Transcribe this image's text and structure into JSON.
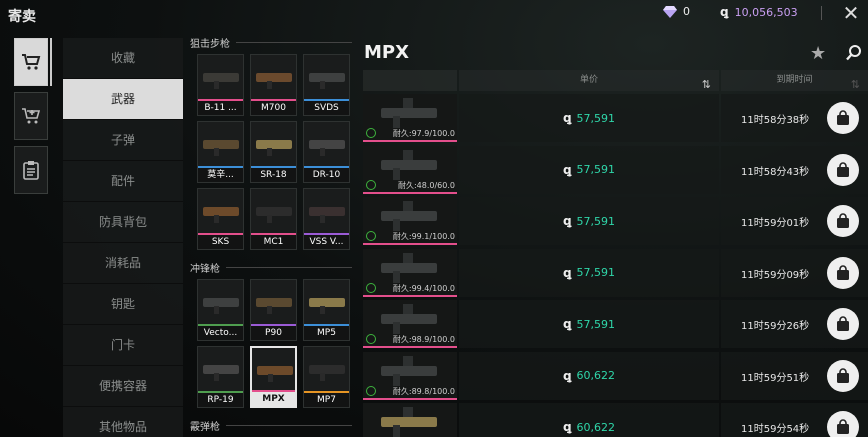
{
  "header": {
    "title": "寄卖",
    "gem_count": "0",
    "coin_count": "10,056,503",
    "colors": {
      "coin": "#c99ff2",
      "price": "#2fd6a9"
    }
  },
  "icon_strip": [
    {
      "icon": "cart-icon",
      "active": true
    },
    {
      "icon": "cart-add-icon",
      "active": false
    },
    {
      "icon": "clipboard-icon",
      "active": false
    }
  ],
  "categories": [
    {
      "label": "收藏",
      "active": false
    },
    {
      "label": "武器",
      "active": true
    },
    {
      "label": "子弹",
      "active": false
    },
    {
      "label": "配件",
      "active": false
    },
    {
      "label": "防具背包",
      "active": false
    },
    {
      "label": "消耗品",
      "active": false
    },
    {
      "label": "钥匙",
      "active": false
    },
    {
      "label": "门卡",
      "active": false
    },
    {
      "label": "便携容器",
      "active": false
    },
    {
      "label": "其他物品",
      "active": false
    }
  ],
  "weapon_sections": [
    {
      "title": "狙击步枪",
      "items": [
        {
          "label": "B-11 ...",
          "rarity": "pink"
        },
        {
          "label": "M700",
          "rarity": "pink"
        },
        {
          "label": "SVDS",
          "rarity": "blue"
        },
        {
          "label": "莫辛...",
          "rarity": "blue"
        },
        {
          "label": "SR-18",
          "rarity": "blue"
        },
        {
          "label": "DR-10",
          "rarity": "blue"
        },
        {
          "label": "SKS",
          "rarity": "pink"
        },
        {
          "label": "MC1",
          "rarity": "pink"
        },
        {
          "label": "VSS V...",
          "rarity": "purple"
        }
      ]
    },
    {
      "title": "冲锋枪",
      "items": [
        {
          "label": "Vecto...",
          "rarity": "green"
        },
        {
          "label": "P90",
          "rarity": "purple"
        },
        {
          "label": "MP5",
          "rarity": "blue"
        },
        {
          "label": "RP-19",
          "rarity": "green"
        },
        {
          "label": "MPX",
          "rarity": "pink",
          "selected": true
        },
        {
          "label": "MP7",
          "rarity": "orange"
        }
      ]
    },
    {
      "title": "霰弹枪",
      "items": []
    }
  ],
  "listing": {
    "title": "MPX",
    "col_price": "单价",
    "col_time": "到期时间",
    "rows": [
      {
        "durability": "耐久:97.9/100.0",
        "price": "57,591",
        "time": "11时58分38秒"
      },
      {
        "durability": "耐久:48.0/60.0",
        "price": "57,591",
        "time": "11时58分43秒"
      },
      {
        "durability": "耐久:99.1/100.0",
        "price": "57,591",
        "time": "11时59分01秒"
      },
      {
        "durability": "耐久:99.4/100.0",
        "price": "57,591",
        "time": "11时59分09秒"
      },
      {
        "durability": "耐久:98.9/100.0",
        "price": "57,591",
        "time": "11时59分26秒"
      },
      {
        "durability": "耐久:89.8/100.0",
        "price": "60,622",
        "time": "11时59分51秒"
      },
      {
        "durability": "",
        "price": "60,622",
        "time": "11时59分54秒"
      }
    ]
  }
}
